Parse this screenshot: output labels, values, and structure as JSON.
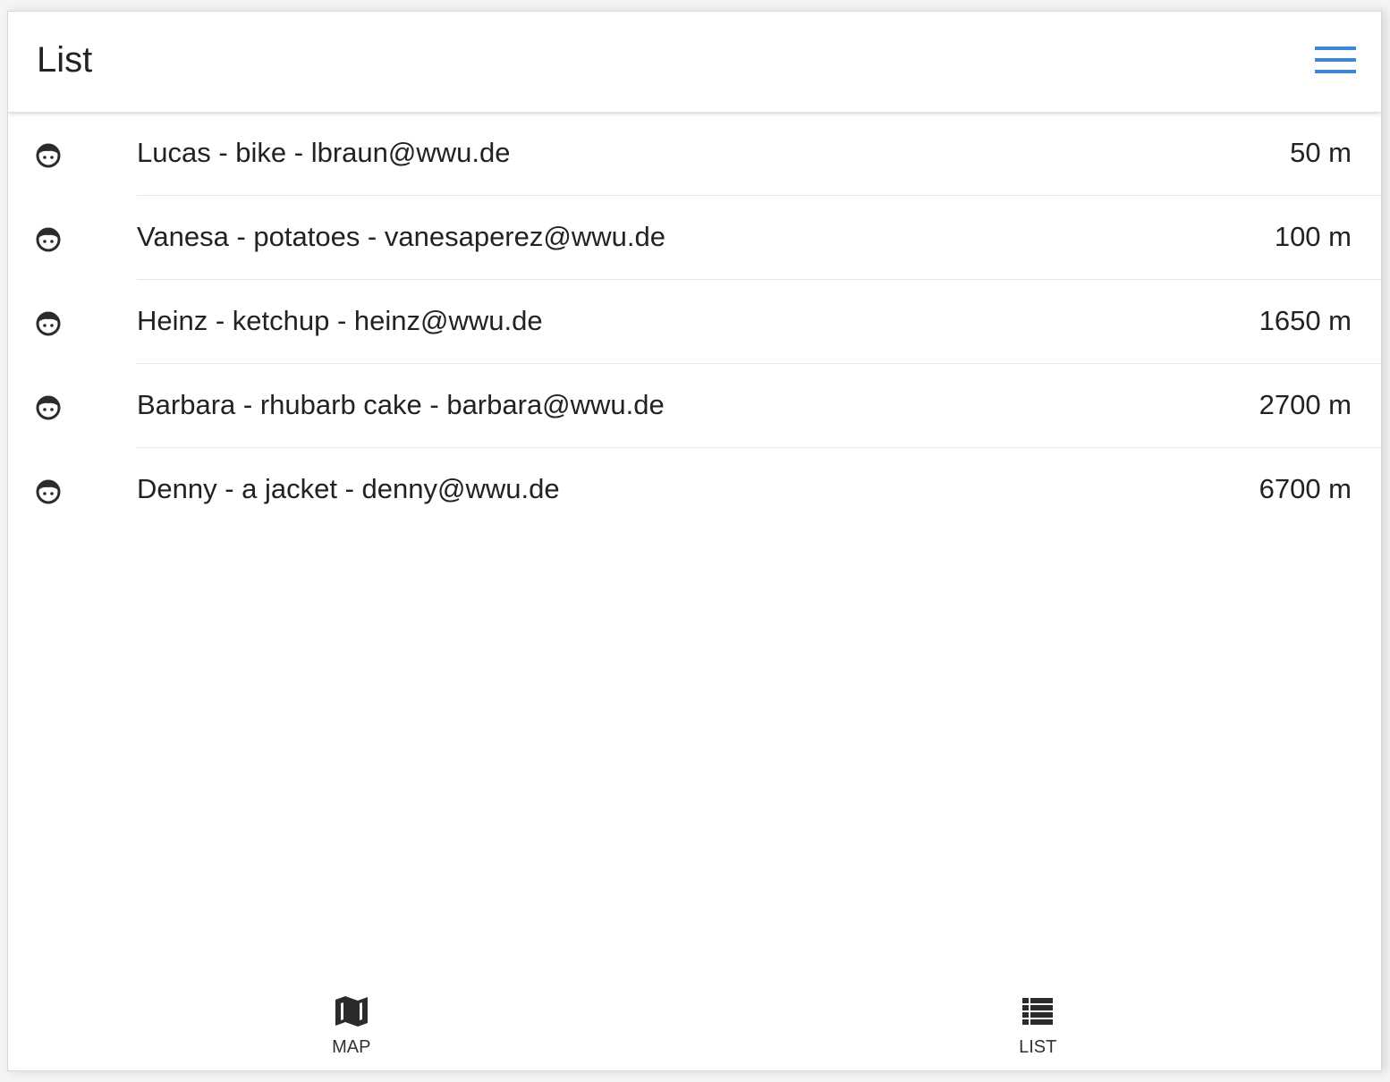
{
  "colors": {
    "accent": "#3b88d8",
    "text": "#222222",
    "divider": "#e6e6e6",
    "icon": "#2b2b2b"
  },
  "header": {
    "title": "List",
    "menu_icon": "hamburger-menu-icon"
  },
  "list": {
    "items": [
      {
        "avatar_icon": "person-face-icon",
        "label": "Lucas - bike - lbraun@wwu.de",
        "distance": "50 m"
      },
      {
        "avatar_icon": "person-face-icon",
        "label": "Vanesa - potatoes - vanesaperez@wwu.de",
        "distance": "100 m"
      },
      {
        "avatar_icon": "person-face-icon",
        "label": "Heinz - ketchup - heinz@wwu.de",
        "distance": "1650 m"
      },
      {
        "avatar_icon": "person-face-icon",
        "label": "Barbara - rhubarb cake - barbara@wwu.de",
        "distance": "2700 m"
      },
      {
        "avatar_icon": "person-face-icon",
        "label": "Denny - a jacket - denny@wwu.de",
        "distance": "6700 m"
      }
    ]
  },
  "tabs": [
    {
      "icon": "map-icon",
      "label": "MAP"
    },
    {
      "icon": "list-icon",
      "label": "LIST"
    }
  ]
}
